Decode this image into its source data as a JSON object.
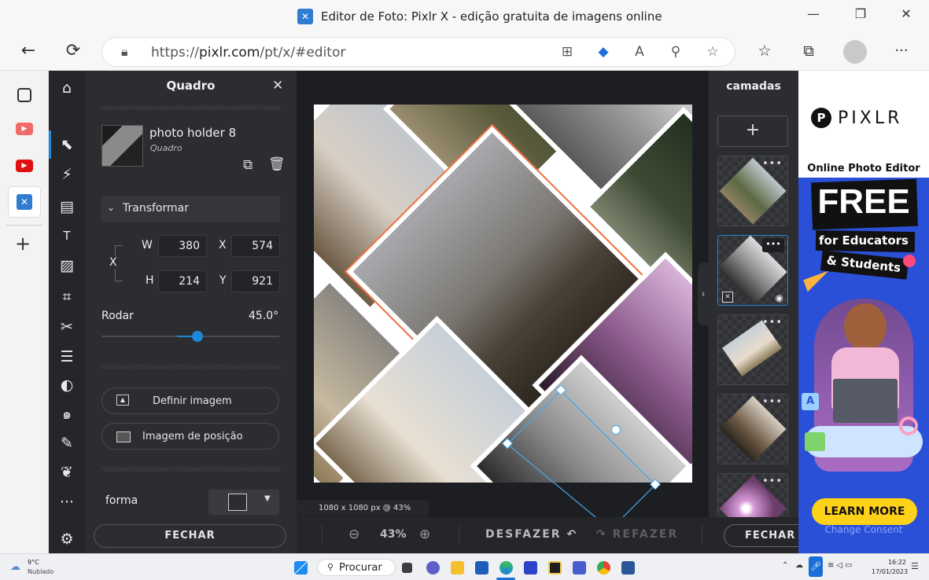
{
  "browser": {
    "title": "Editor de Foto: Pixlr X - edição gratuita de imagens online",
    "url_prefix": "https://",
    "url_domain": "pixlr.com",
    "url_path": "/pt/x/#editor"
  },
  "tools_panel": {
    "title": "Quadro",
    "layer_name": "photo holder 8",
    "layer_type": "Quadro",
    "section": "Transformar",
    "link_label": "X",
    "w_label": "W",
    "w_value": "380",
    "x_label": "X",
    "x_value": "574",
    "h_label": "H",
    "h_value": "214",
    "y_label": "Y",
    "y_value": "921",
    "rotate_label": "Rodar",
    "rotate_value": "45.0°",
    "rotate_fraction": 0.54,
    "set_image": "Definir imagem",
    "position_image": "Imagem de posição",
    "shape_label": "forma",
    "close": "FECHAR"
  },
  "canvas": {
    "size_info": "1080 x 1080 px @ 43%"
  },
  "bottom_bar": {
    "zoom": "43%",
    "undo": "DESFAZER",
    "redo": "REFAZER",
    "close": "FECHAR"
  },
  "layers": {
    "title": "camadas",
    "add": "+",
    "more": "•••"
  },
  "ad": {
    "brand": "PIXLR",
    "headline": "Online Photo Editor",
    "free": "FREE",
    "line1": "for Educators",
    "line2": "& Students",
    "cta": "LEARN MORE",
    "consent": "Change Consent"
  },
  "taskbar": {
    "temp": "9°C",
    "weather": "Nublado",
    "search": "Procurar",
    "time": "16:22",
    "date": "17/01/2023"
  },
  "colors": {
    "accent": "#1e88d8",
    "panel": "#2c2d31",
    "tools": "#25262a",
    "ad_bg": "#2a50d8",
    "cta": "#ffd21a"
  }
}
